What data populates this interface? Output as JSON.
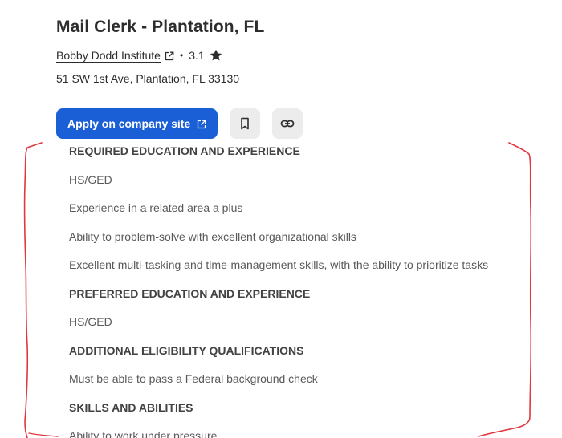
{
  "job": {
    "title": "Mail Clerk - Plantation, FL",
    "company": "Bobby Dodd Institute",
    "separator": "•",
    "rating": "3.1",
    "address": "51 SW 1st Ave, Plantation, FL 33130"
  },
  "actions": {
    "apply_label": "Apply on company site",
    "apply_icon": "external-link-icon",
    "save_icon": "bookmark-icon",
    "copy_link_icon": "link-icon"
  },
  "description": [
    {
      "type": "heading",
      "text": "REQUIRED EDUCATION AND EXPERIENCE"
    },
    {
      "type": "item",
      "text": "HS/GED"
    },
    {
      "type": "item",
      "text": "Experience in a related area a plus"
    },
    {
      "type": "item",
      "text": "Ability to problem-solve with excellent organizational skills"
    },
    {
      "type": "item",
      "text": "Excellent multi-tasking and time-management skills, with the ability to prioritize tasks"
    },
    {
      "type": "heading",
      "text": "PREFERRED EDUCATION AND EXPERIENCE"
    },
    {
      "type": "item",
      "text": "HS/GED"
    },
    {
      "type": "heading",
      "text": "ADDITIONAL ELIGIBILITY QUALIFICATIONS"
    },
    {
      "type": "item",
      "text": "Must be able to pass a Federal background check"
    },
    {
      "type": "heading",
      "text": "SKILLS AND ABILITIES"
    },
    {
      "type": "item",
      "text": "Ability to work under pressure"
    }
  ],
  "colors": {
    "primary_button": "#1a5fd6",
    "icon_button_bg": "#ececec",
    "annotation_bracket": "#e0383e"
  }
}
